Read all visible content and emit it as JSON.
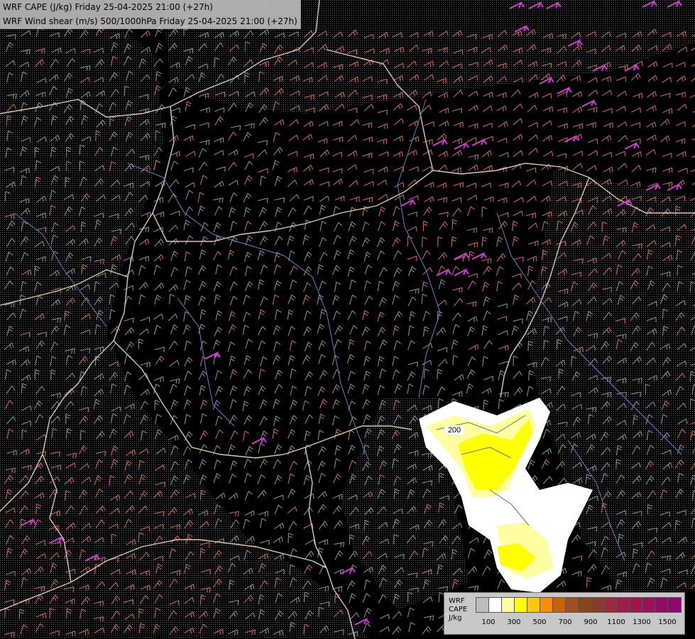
{
  "header": {
    "title_line1": "WRF CAPE (J/kg) Friday 25-04-2025 21:00 (+27h)",
    "title_line2": "WRF Wind shear (m/s) 500/1000hPa Friday 25-04-2025 21:00 (+27h)"
  },
  "map": {
    "contour_label": "200",
    "barb_color_weak": "#8c8c8c",
    "barb_color_medium": "#c46a5f",
    "barb_color_strong": "#d23cd6",
    "border_color": "#e0c9a0",
    "river_color": "#5f86c8"
  },
  "legend": {
    "name_line1": "WRF",
    "name_line2": "CAPE",
    "name_line3": "J/kg",
    "colors": [
      "#bdbdbd",
      "#ffffff",
      "#fefea0",
      "#ffff00",
      "#ffc800",
      "#ff8c00",
      "#c86400",
      "#a0501e",
      "#8b4513",
      "#8c3a28",
      "#9b2a3c",
      "#a01e46",
      "#a01450",
      "#9c0f5a",
      "#960a64",
      "#8c0a6e"
    ],
    "ticks": [
      "100",
      "300",
      "500",
      "700",
      "900",
      "1100",
      "1300",
      "1500"
    ]
  }
}
